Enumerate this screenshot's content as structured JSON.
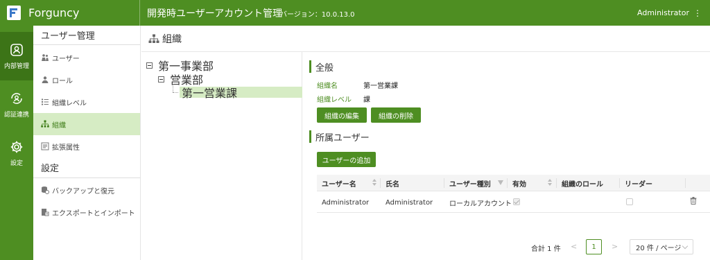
{
  "header": {
    "brand": "Forguncy",
    "title": "開発時ユーザーアカウント管理",
    "version": "バージョン：10.0.13.0",
    "user": "Administrator",
    "menu_glyph": "⋮"
  },
  "rail": {
    "items": [
      {
        "label": "内部管理",
        "icon": "user-square-icon"
      },
      {
        "label": "認証連携",
        "icon": "sync-user-icon"
      },
      {
        "label": "設定",
        "icon": "gear-icon"
      }
    ]
  },
  "sidebar": {
    "section_user": "ユーザー管理",
    "items": [
      {
        "label": "ユーザー",
        "icon": "users-icon"
      },
      {
        "label": "ロール",
        "icon": "role-icon"
      },
      {
        "label": "組織レベル",
        "icon": "org-level-icon"
      },
      {
        "label": "組織",
        "icon": "org-tree-icon"
      },
      {
        "label": "拡張属性",
        "icon": "ext-attr-icon"
      }
    ],
    "section_settings": "設定",
    "settings_items": [
      {
        "label": "バックアップと復元",
        "icon": "backup-icon"
      },
      {
        "label": "エクスポートとインポート",
        "icon": "export-icon"
      }
    ]
  },
  "page": {
    "heading": "組織"
  },
  "tree": {
    "nodes": [
      {
        "label": "第一事業部"
      },
      {
        "label": "営業部"
      },
      {
        "label": "第一営業課"
      }
    ]
  },
  "general": {
    "title": "全般",
    "name_label": "組織名",
    "name_value": "第一営業課",
    "level_label": "組織レベル",
    "level_value": "課",
    "edit_button": "組織の編集",
    "delete_button": "組織の削除"
  },
  "members": {
    "title": "所属ユーザー",
    "add_button": "ユーザーの追加",
    "columns": [
      "ユーザー名",
      "氏名",
      "ユーザー種別",
      "有効",
      "組織のロール",
      "リーダー"
    ],
    "rows": [
      {
        "username": "Administrator",
        "fullname": "Administrator",
        "type": "ローカルアカウント",
        "enabled": true,
        "role": "",
        "leader": false
      }
    ]
  },
  "pager": {
    "total": "合計 1 件",
    "prev": "<",
    "page": "1",
    "next": ">",
    "page_size": "20 件 / ページ"
  },
  "colors": {
    "accent": "#4e8e22",
    "accent_dark": "#3c7417",
    "selected_bg": "#d6ecc4"
  }
}
